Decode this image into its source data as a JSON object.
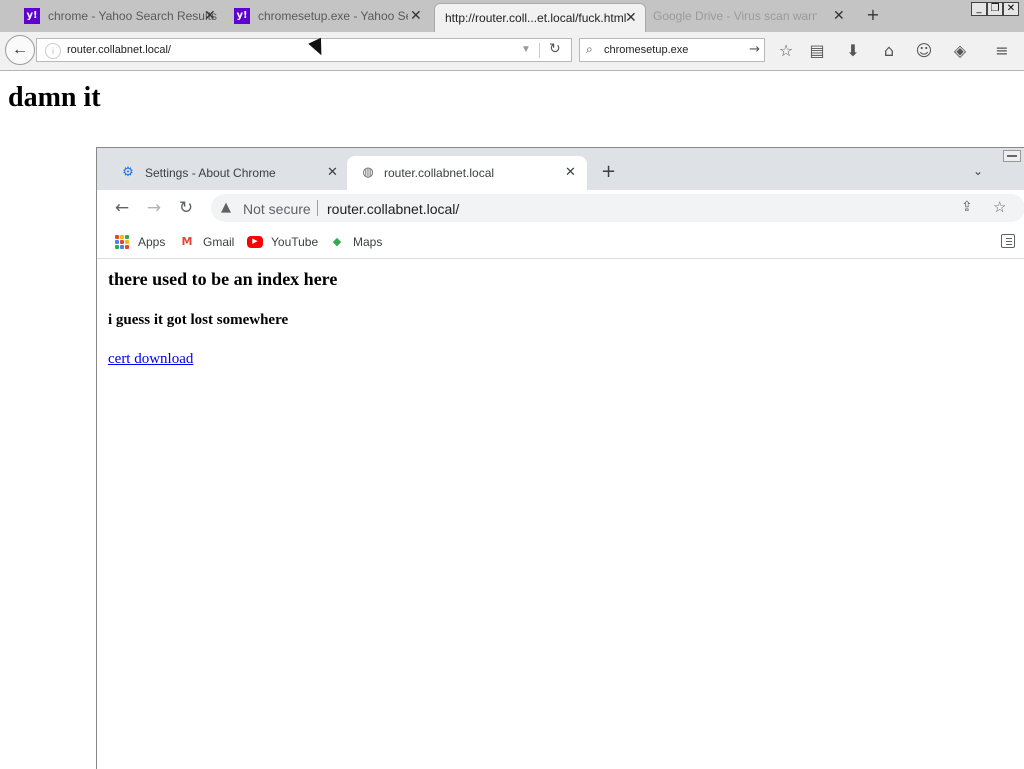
{
  "outer": {
    "tabs": [
      {
        "label": "chrome - Yahoo Search Results",
        "icon": "yahoo-icon"
      },
      {
        "label": "chromesetup.exe - Yahoo Se...",
        "icon": "yahoo-icon"
      },
      {
        "label": "http://router.coll...et.local/fuck.html"
      },
      {
        "label": "Google Drive - Virus scan warning"
      }
    ],
    "tab_close": "✕",
    "new_tab": "+",
    "window_controls": {
      "minimize": "_",
      "restore": "❐",
      "close": "✕"
    },
    "url": "router.collabnet.local/",
    "search_value": "chromesetup.exe",
    "page_heading": "damn it"
  },
  "inner": {
    "tabs": [
      {
        "label": "Settings - About Chrome",
        "icon": "gear-icon",
        "color": "#1a73e8"
      },
      {
        "label": "router.collabnet.local",
        "icon": "globe-icon"
      }
    ],
    "tab_close": "✕",
    "new_tab": "+",
    "security": "Not secure",
    "url": "router.collabnet.local/",
    "bookmarks": [
      "Apps",
      "Gmail",
      "YouTube",
      "Maps"
    ],
    "page": {
      "h2": "there used to be an index here",
      "h4": "i guess it got lost somewhere",
      "link": "cert download"
    }
  },
  "colors": {
    "yahoo_purple": "#5f01d1",
    "link": "#0000ee",
    "chrome_tabstrip": "#dee1e6",
    "chrome_omnibox": "#f1f3f4"
  }
}
